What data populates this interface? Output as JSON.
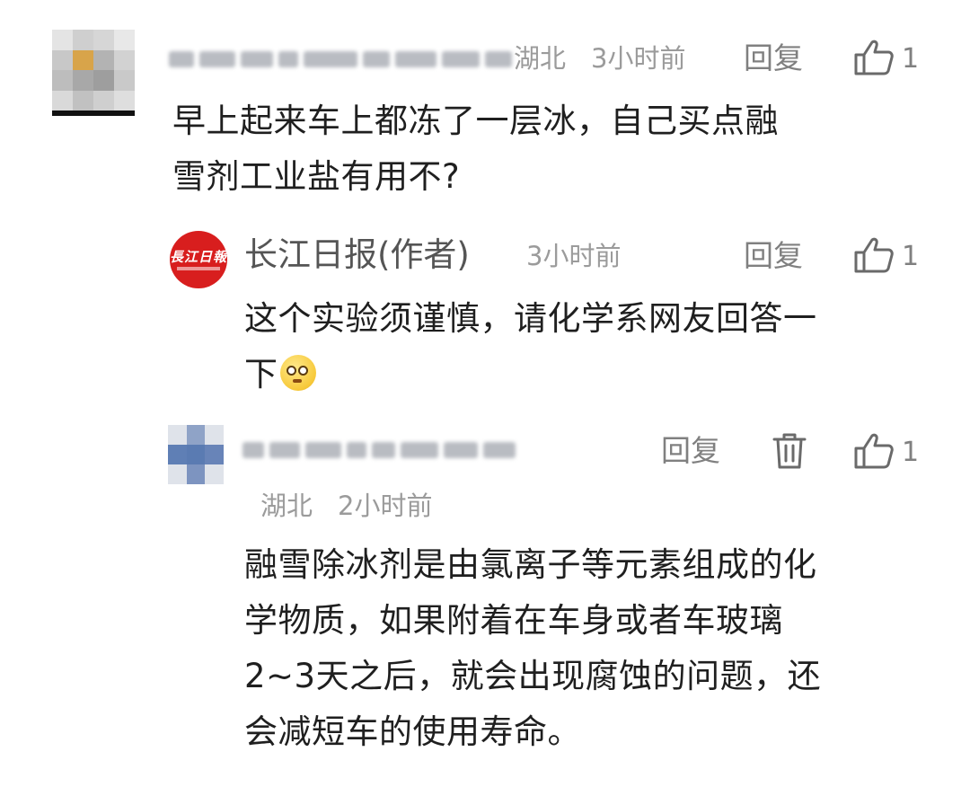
{
  "comments": [
    {
      "location": "湖北",
      "time": "3小时前",
      "reply_label": "回复",
      "like_count": "1",
      "text_line1": "早上起来车上都冻了一层冰，自己买点融",
      "text_line2": "雪剂工业盐有用不?"
    },
    {
      "author": "长江日报(作者)",
      "time": "3小时前",
      "reply_label": "回复",
      "like_count": "1",
      "logo_text": "長江日報",
      "text_line1": "这个实验须谨慎，请化学系网友回答一",
      "text_line2": "下",
      "emoji": "thinking-emoji"
    },
    {
      "location": "湖北",
      "time": "2小时前",
      "reply_label": "回复",
      "like_count": "1",
      "text_line1": "融雪除冰剂是由氯离子等元素组成的化",
      "text_line2": "学物质，如果附着在车身或者车玻璃",
      "text_line3": "2~3天之后，就会出现腐蚀的问题，还",
      "text_line4": "会减短车的使用寿命。"
    }
  ],
  "colors": {
    "text": "#1f1f1f",
    "meta": "#9b9b9b",
    "action": "#808080",
    "logo_red": "#d81e1e"
  }
}
